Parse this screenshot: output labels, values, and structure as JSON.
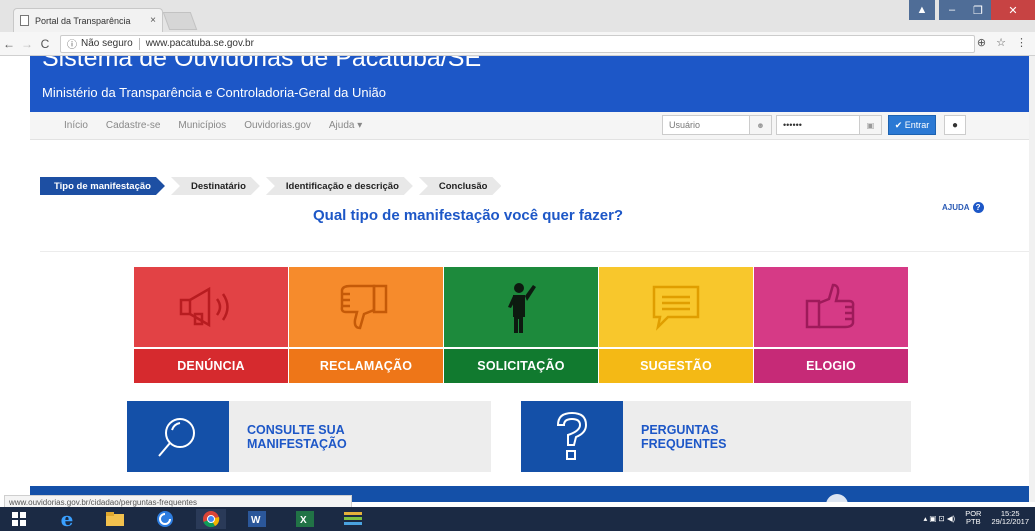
{
  "browser": {
    "tab_title": "Portal da Transparência",
    "tab_close": "×",
    "url_security": "Não seguro",
    "url": "www.pacatuba.se.gov.br",
    "status_url": "www.ouvidorias.gov.br/cidadao/perguntas-frequentes"
  },
  "header": {
    "title": "Sistema de Ouvidorias de Pacatuba/SE",
    "subtitle": "Ministério da Transparência e Controladoria-Geral da União"
  },
  "nav": {
    "items": [
      "Início",
      "Cadastre-se",
      "Municípios",
      "Ouvidorias.gov",
      "Ajuda ▾"
    ],
    "user_placeholder": "Usuário",
    "password_value": "••••••",
    "login_label": "✔ Entrar",
    "help_label": "❶"
  },
  "steps": [
    "Tipo de manifestação",
    "Destinatário",
    "Identificação e descrição",
    "Conclusão"
  ],
  "help_link": "AJUDA",
  "question": "Qual tipo de manifestação você quer fazer?",
  "categories": [
    {
      "label": "DENÚNCIA",
      "icon": "megaphone-icon",
      "color_top": "#e24245",
      "color_bar": "#d62a2e"
    },
    {
      "label": "RECLAMAÇÃO",
      "icon": "thumbs-down-icon",
      "color_top": "#f68b2c",
      "color_bar": "#ee7618"
    },
    {
      "label": "SOLICITAÇÃO",
      "icon": "person-raising-hand-icon",
      "color_top": "#1d8a3c",
      "color_bar": "#117a2f"
    },
    {
      "label": "SUGESTÃO",
      "icon": "speech-bubble-icon",
      "color_top": "#f8c72c",
      "color_bar": "#f4b915"
    },
    {
      "label": "ELOGIO",
      "icon": "thumbs-up-icon",
      "color_top": "#d63a86",
      "color_bar": "#c62a77"
    }
  ],
  "cards": {
    "consult": {
      "line1": "CONSULTE SUA",
      "line2": "MANIFESTAÇÃO",
      "icon": "magnifier-icon"
    },
    "faq": {
      "line1": "PERGUNTAS",
      "line2": "FREQUENTES",
      "icon": "question-mark-icon"
    }
  },
  "taskbar": {
    "lang_line1": "POR",
    "lang_line2": "PTB",
    "time": "15:25",
    "date": "29/12/2017"
  }
}
